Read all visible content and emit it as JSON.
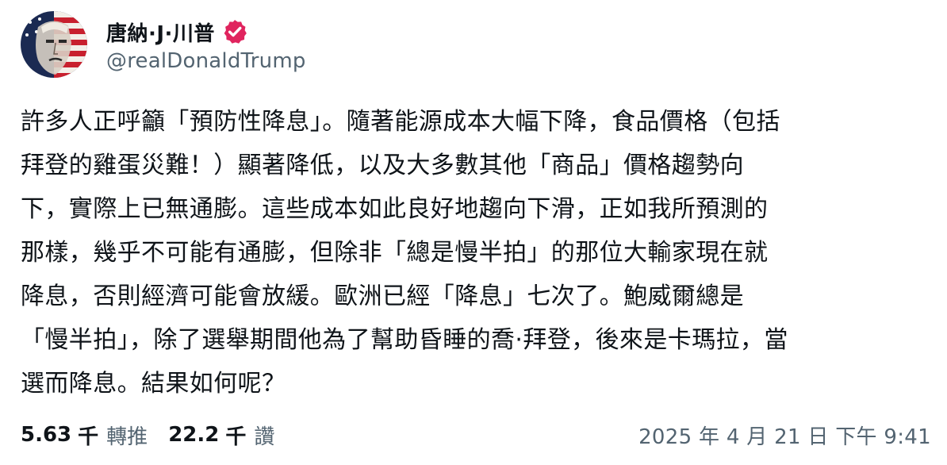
{
  "author": {
    "display_name": "唐納·J·川普",
    "handle": "@realDonaldTrump",
    "verified_icon": "verified-badge-icon",
    "badge_color": "#e0245e"
  },
  "post": {
    "lines": [
      "許多人正呼籲「預防性降息」。隨著能源成本大幅下降，食品價格（包括",
      "拜登的雞蛋災難！）顯著降低，以及大多數其他「商品」價格趨勢向",
      "下，實際上已無通膨。這些成本如此良好地趨向下滑，正如我所預測的",
      "那樣，幾乎不可能有通膨，但除非「總是慢半拍」的那位大輸家現在就",
      "降息，否則經濟可能會放緩。歐洲已經「降息」七次了。鮑威爾總是",
      "「慢半拍」，除了選舉期間他為了幫助昏睡的喬·拜登，後來是卡瑪拉，當",
      "選而降息。結果如何呢？"
    ]
  },
  "stats": {
    "reposts": {
      "count": "5.63",
      "unit": "千",
      "label": "轉推"
    },
    "likes": {
      "count": "22.2",
      "unit": "千",
      "label": "讚"
    }
  },
  "timestamp": "2025 年 4 月 21 日 下午 9:41"
}
